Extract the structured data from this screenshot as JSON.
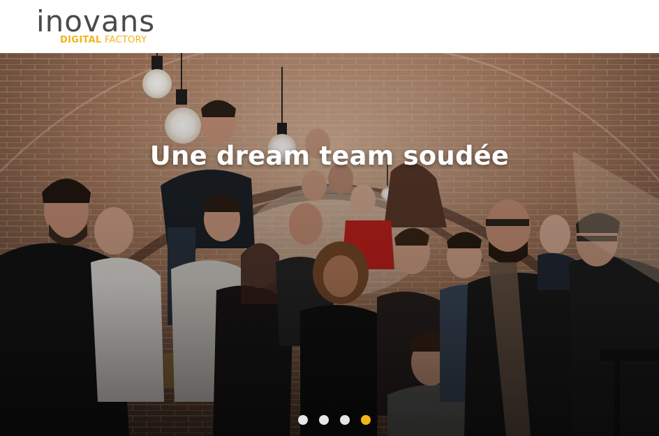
{
  "brand": {
    "logo_word": "inovans",
    "logo_sub_bold": "DIGITAL",
    "logo_sub_rest": "FACTORY",
    "logo_color": "#4a4a4a",
    "accent_color": "#f2b417"
  },
  "hero": {
    "title": "Une dream team soudée",
    "image": "team-photo-in-brick-vaulted-cellar",
    "slides": [
      {
        "label": "slide-1",
        "active": false
      },
      {
        "label": "slide-2",
        "active": false
      },
      {
        "label": "slide-3",
        "active": false
      },
      {
        "label": "slide-4",
        "active": true
      }
    ]
  }
}
